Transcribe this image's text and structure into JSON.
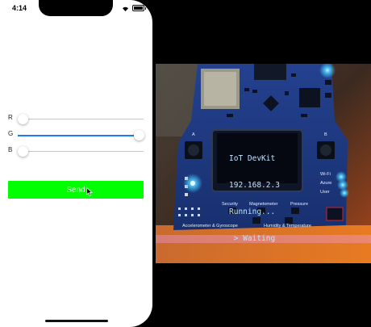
{
  "status_bar": {
    "time": "4:14"
  },
  "sliders": [
    {
      "label": "R",
      "value": 0.0
    },
    {
      "label": "G",
      "value": 1.0
    },
    {
      "label": "B",
      "value": 0.0
    }
  ],
  "send_button": {
    "label": "Send"
  },
  "photo": {
    "oled_lines": [
      "IoT DevKit",
      "192.168.2.3",
      "Running...",
      " > Waiting"
    ],
    "button_labels": {
      "a": "A",
      "b": "B"
    },
    "led_labels": {
      "wifi": "Wi-Fi",
      "azure": "Azure",
      "user": "User"
    },
    "sensor_labels": {
      "security": "Security",
      "magnetometer": "Magnetometer",
      "pressure": "Pressure",
      "accelerometer": "Accelerometer & Gyroscope",
      "humidity": "Humidity & Temperature"
    }
  },
  "colors": {
    "send_button_bg": "#00ff00",
    "slider_active": "#1e7cf2",
    "pcb_blue": "#1a3a8c",
    "led_blue": "#4fd2ff"
  }
}
